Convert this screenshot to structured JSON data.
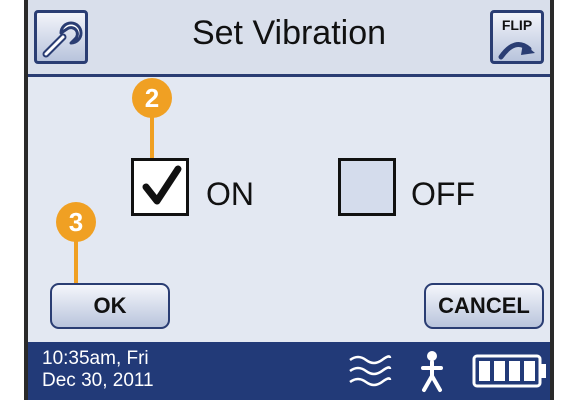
{
  "header": {
    "title": "Set Vibration",
    "left_icon": "wrench-icon",
    "right_button_label": "FLIP",
    "right_icon": "flip-arrow-icon"
  },
  "options": [
    {
      "label": "ON",
      "checked": true
    },
    {
      "label": "OFF",
      "checked": false
    }
  ],
  "buttons": {
    "ok": "OK",
    "cancel": "CANCEL"
  },
  "callouts": [
    "2",
    "3"
  ],
  "status": {
    "time": "10:35am, Fri",
    "date": "Dec 30, 2011",
    "icons": [
      "vibration-waves-icon",
      "person-icon",
      "battery-icon"
    ],
    "battery_level": 1.0
  },
  "colors": {
    "accent": "#223a78",
    "screen_bg": "#e3e8f2",
    "callout": "#f0a023"
  }
}
